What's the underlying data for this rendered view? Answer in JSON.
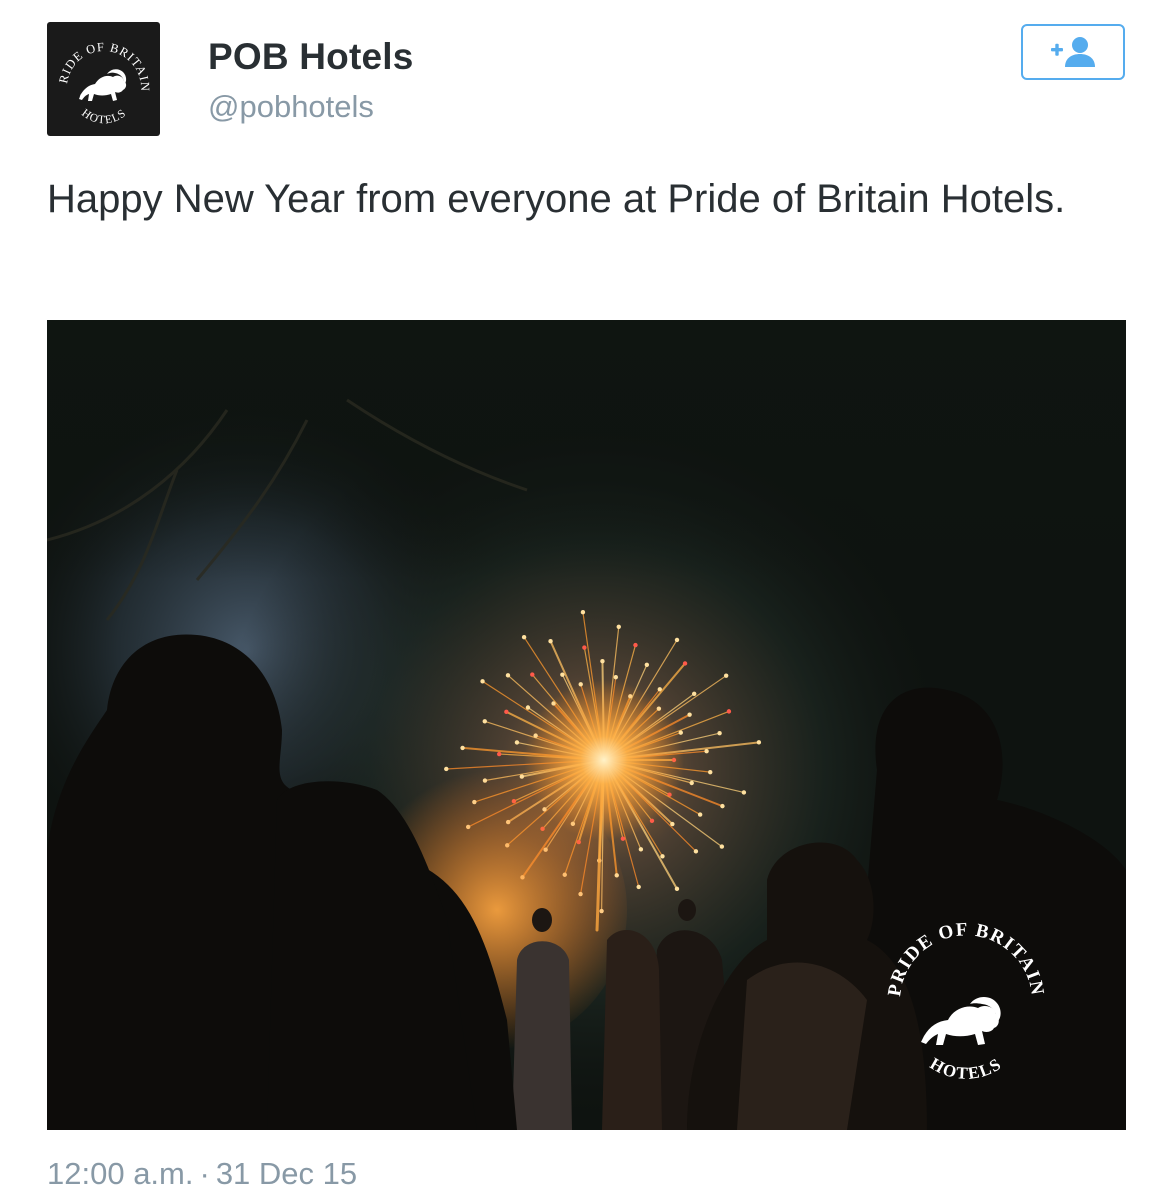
{
  "account": {
    "display_name": "POB Hotels",
    "handle": "@pobhotels",
    "avatar_logo": {
      "arc_text": "PRIDE OF BRITAIN",
      "bottom_text": "HOTELS",
      "trademark": "™"
    }
  },
  "follow_button": {
    "icon": "add-user-icon",
    "accent": "#55acee"
  },
  "tweet": {
    "text": "Happy New Year from everyone at Pride of Britain Hotels."
  },
  "media": {
    "watermark": {
      "arc_text": "PRIDE OF BRITAIN",
      "bottom_text": "HOTELS",
      "trademark": "™"
    }
  },
  "meta": {
    "time": "12:00 a.m.",
    "separator": "·",
    "date": "31 Dec 15"
  },
  "colors": {
    "name": "#292f33",
    "secondary": "#8899a6",
    "accent": "#55acee"
  }
}
